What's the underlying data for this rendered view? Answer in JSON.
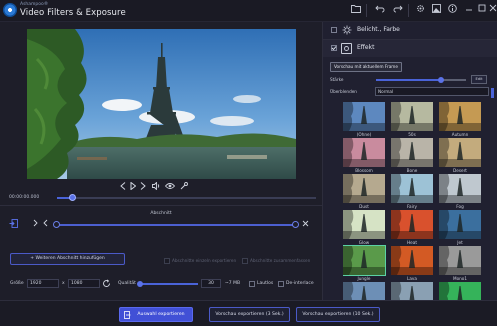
{
  "app": {
    "brand_small": "Ashampoo®",
    "title": "Video Filters & Exposure"
  },
  "titlebar": {
    "icons": [
      "folder-icon",
      "undo-icon",
      "redo-icon",
      "settings-icon",
      "image-icon",
      "info-icon",
      "minimize-icon",
      "maximize-icon",
      "close-icon"
    ]
  },
  "player": {
    "timecode": "00:00:00.000",
    "position": 0.06,
    "controls": [
      "prev-icon",
      "play-icon",
      "next-icon",
      "volume-icon",
      "eye-icon",
      "eyedropper-icon"
    ]
  },
  "section": {
    "label": "Abschnitt",
    "add_button": "+ Weiteren Abschnitt hinzufügen",
    "export_single": "Abschnitte einzeln exportieren",
    "export_merge": "Abschnitte zusammenfassen"
  },
  "output": {
    "size_label": "Größe",
    "width": "1920",
    "x": "x",
    "height": "1080",
    "quality_label": "Qualität",
    "quality_value": "30",
    "file_size": "~7 MB",
    "loop_label": "Lautlos",
    "deinterlace_label": "De-interlace"
  },
  "bottom": {
    "export_selection": "Auswahl exportieren",
    "export_preview3": "Vorschau exportieren (3 Sek.)",
    "export_preview10": "Vorschau exportieren (10 Sek.)"
  },
  "panel": {
    "cat1": "Belicht., Farbe",
    "cat2": "Effekt",
    "preview_button": "Vorschau mit aktuellem Frame",
    "strength_label": "Stärke",
    "strength_value": 0.72,
    "edit_button": "Edit",
    "blend_label": "Überblenden",
    "blend_value": "Normal"
  },
  "effects": [
    {
      "name": "(Ohne)",
      "tint": "#5d88bf"
    },
    {
      "name": "50s",
      "tint": "#b6b9a0"
    },
    {
      "name": "Autumn",
      "tint": "#c59a53"
    },
    {
      "name": "Blossom",
      "tint": "#c98b9e"
    },
    {
      "name": "Bone",
      "tint": "#b9b4a8"
    },
    {
      "name": "Desert",
      "tint": "#c3ab7d"
    },
    {
      "name": "Dust",
      "tint": "#b5a98f"
    },
    {
      "name": "Fairy",
      "tint": "#9dc2d6"
    },
    {
      "name": "Fog",
      "tint": "#bfc8cf"
    },
    {
      "name": "Glow",
      "tint": "#d6e3c5"
    },
    {
      "name": "Heat",
      "tint": "#d9512d"
    },
    {
      "name": "Jet",
      "tint": "#3b6f9e"
    },
    {
      "name": "Jungle",
      "tint": "#5a9a4a"
    },
    {
      "name": "Lava",
      "tint": "#d35a24"
    },
    {
      "name": "Mono1",
      "tint": "#9a9a9a"
    },
    {
      "name": "",
      "tint": "#6d8fb6"
    },
    {
      "name": "",
      "tint": "#8aa0b3"
    },
    {
      "name": "",
      "tint": "#35b35a"
    }
  ],
  "selected_effect": "Jungle"
}
